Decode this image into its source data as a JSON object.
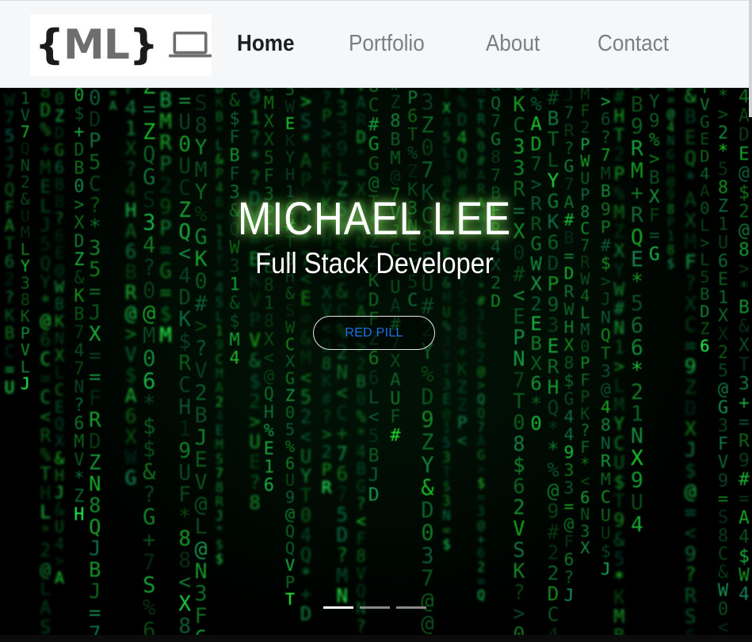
{
  "navbar": {
    "logo": {
      "brace_open": "{",
      "initials": "ML",
      "brace_close": "}",
      "icon": "laptop-icon"
    },
    "links": [
      {
        "label": "Home",
        "active": true
      },
      {
        "label": "Portfolio",
        "active": false
      },
      {
        "label": "About",
        "active": false
      },
      {
        "label": "Contact",
        "active": false
      }
    ]
  },
  "hero": {
    "name": "MICHAEL LEE",
    "subtitle": "Full Stack Developer",
    "button_label": "RED PILL",
    "background": "matrix-code-rain",
    "carousel": {
      "slide_count": 3,
      "active_index": 0
    }
  },
  "colors": {
    "navbar_bg": "#f6f7f9",
    "nav_active": "#1d1f21",
    "nav_inactive": "#7b7f83",
    "matrix_green": "#22c34a",
    "button_text": "#1d6fe8"
  }
}
